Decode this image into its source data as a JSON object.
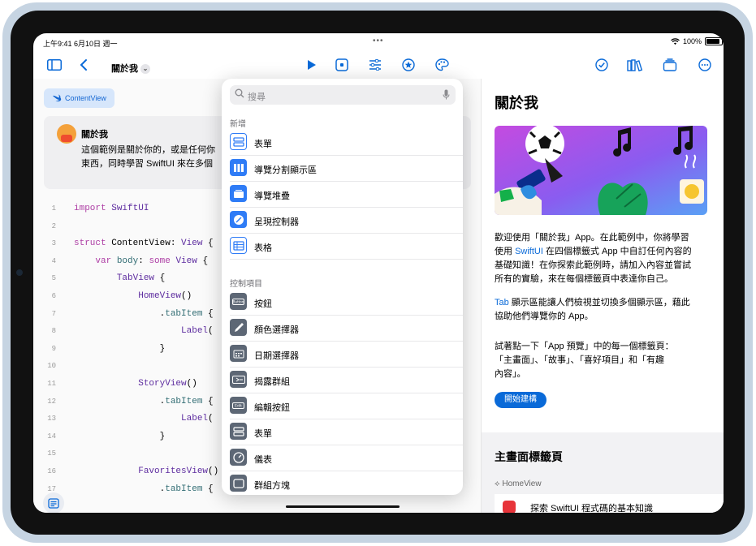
{
  "status": {
    "time": "上午9:41  6月10日 週一",
    "battery": "100%"
  },
  "toolbar": {
    "title": "關於我"
  },
  "editor": {
    "tag": "ContentView",
    "guide_title": "關於我",
    "guide_line1": "這個範例是關於你的，或是任何你",
    "guide_line2": "東西，同時學習 SwiftUI 來在多個",
    "code": [
      {
        "n": "1",
        "t": "import SwiftUI"
      },
      {
        "n": "2",
        "t": ""
      },
      {
        "n": "3",
        "t": "struct ContentView: View {"
      },
      {
        "n": "4",
        "t": "    var body: some View {"
      },
      {
        "n": "5",
        "t": "        TabView {"
      },
      {
        "n": "6",
        "t": "            HomeView()"
      },
      {
        "n": "7",
        "t": "                .tabItem {"
      },
      {
        "n": "8",
        "t": "                    Label("
      },
      {
        "n": "9",
        "t": "                }"
      },
      {
        "n": "10",
        "t": ""
      },
      {
        "n": "11",
        "t": "            StoryView()"
      },
      {
        "n": "12",
        "t": "                .tabItem {"
      },
      {
        "n": "13",
        "t": "                    Label("
      },
      {
        "n": "14",
        "t": "                }"
      },
      {
        "n": "15",
        "t": ""
      },
      {
        "n": "16",
        "t": "            FavoritesView()"
      },
      {
        "n": "17",
        "t": "                .tabItem {"
      }
    ]
  },
  "popover": {
    "search_placeholder": "搜尋",
    "section_new": "新增",
    "new_items": [
      "表單",
      "導覽分割顯示區",
      "導覽堆疊",
      "呈現控制器",
      "表格"
    ],
    "section_controls": "控制項目",
    "control_items": [
      "按鈕",
      "顏色選擇器",
      "日期選擇器",
      "揭露群組",
      "編輯按鈕",
      "表單",
      "儀表",
      "群組方塊"
    ]
  },
  "preview": {
    "title": "關於我",
    "p1_lines": [
      "歡迎使用「關於我」App。在此範例中，你將學習",
      "使用 SwiftUI 在四個標籤式 App 中自訂任何內容的",
      "基礎知識！在你探索此範例時，請加入內容並嘗試",
      "所有的實驗，來在每個標籤頁中表達你自己。"
    ],
    "p2_lines": [
      "Tab 顯示區能讓人們檢視並切換多個顯示區，藉此",
      "協助他們導覽你的 App。"
    ],
    "p3_lines": [
      "試著點一下「App 預覽」中的每一個標籤頁：",
      "「主畫面」、「故事」、「喜好項目」和「有趣",
      "內容」。"
    ],
    "start_button": "開始建構",
    "section_title": "主畫面標籤頁",
    "section_sub": "HomeView",
    "card_text": "探索 SwiftUI 程式碼的基本知識"
  },
  "colors": {
    "accent": "#0a6ad8",
    "bezel": "#c6d4e2"
  }
}
